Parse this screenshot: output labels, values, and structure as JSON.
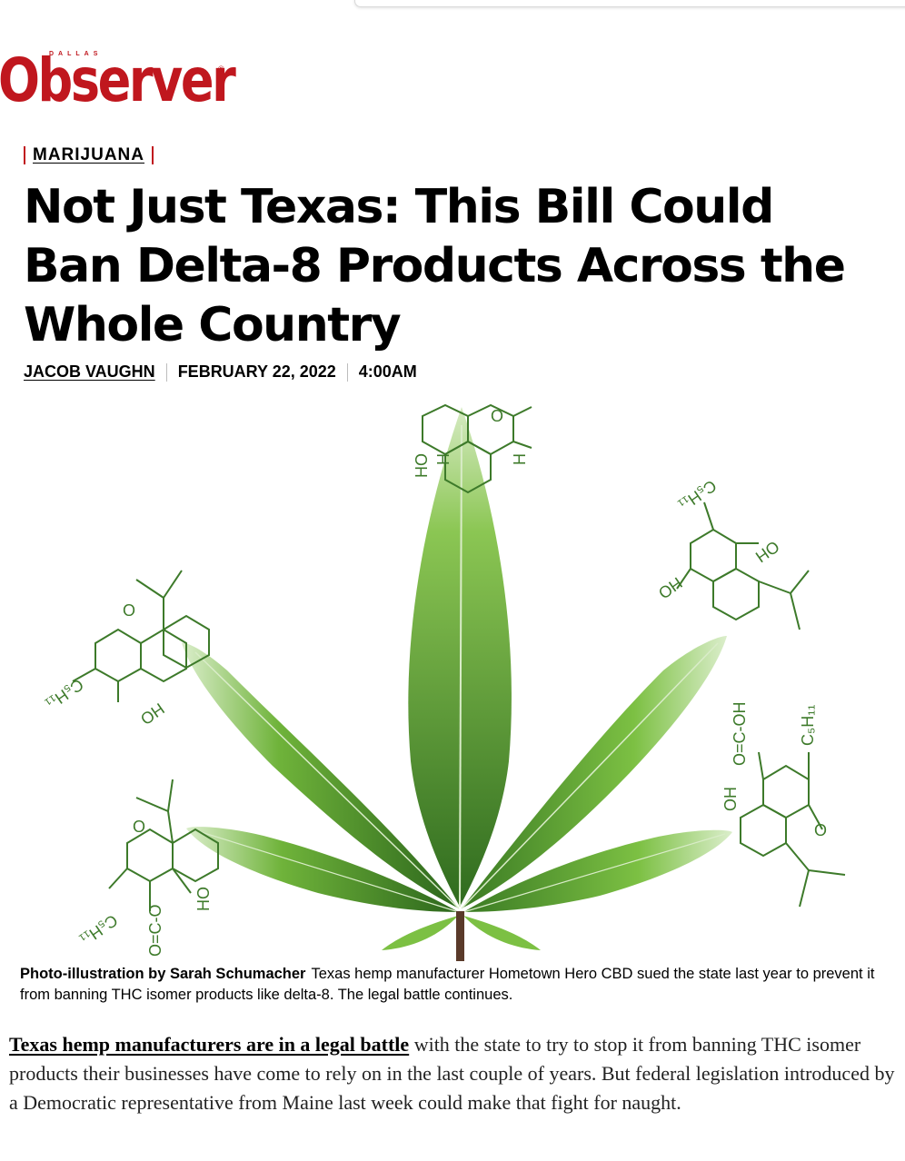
{
  "site": {
    "logo_small": "DALLAS",
    "logo_main": "Observer",
    "logo_reg": "®"
  },
  "article": {
    "category": "MARIJUANA",
    "headline": "Not Just Texas: This Bill Could Ban Delta-8 Products Across the Whole Country",
    "author": "JACOB VAUGHN",
    "date": "FEBRUARY 22, 2022",
    "time": "4:00AM",
    "image": {
      "molecule_labels": {
        "top_ho": "HO",
        "top_h_left": "H",
        "top_h_right": "H",
        "top_o": "O",
        "left_c5h11": "C₅H₁₁",
        "left_ho": "HO",
        "left_o": "O",
        "right_c5h11": "C₅H₁₁",
        "right_oh": "OH",
        "right_ho": "HO",
        "lowleft_c5h11": "C₅H₁₁",
        "lowleft_ho": "HO",
        "lowleft_o": "O",
        "lowleft_coo": "O=C-O",
        "lowright_cooh": "O=C-OH",
        "lowright_c5h11": "C₅H₁₁",
        "lowright_oh": "OH",
        "lowright_o": "O"
      }
    },
    "caption_credit": "Photo-illustration by Sarah Schumacher",
    "caption_text": "Texas hemp manufacturer Hometown Hero CBD sued the state last year to prevent it from banning THC isomer products like delta-8. The legal battle continues.",
    "body_link": "Texas hemp manufacturers are in a legal battle",
    "body_rest": " with the state to try to stop it from banning THC isomer products their businesses have come to rely on in the last couple of years. But federal legislation introduced by a Democratic representative from Maine last week could make that fight for naught."
  },
  "colors": {
    "brand_red": "#c0171e",
    "leaf_dark": "#2f6b1e",
    "leaf_light": "#7cc043",
    "molecule_green": "#3d7a2a"
  }
}
